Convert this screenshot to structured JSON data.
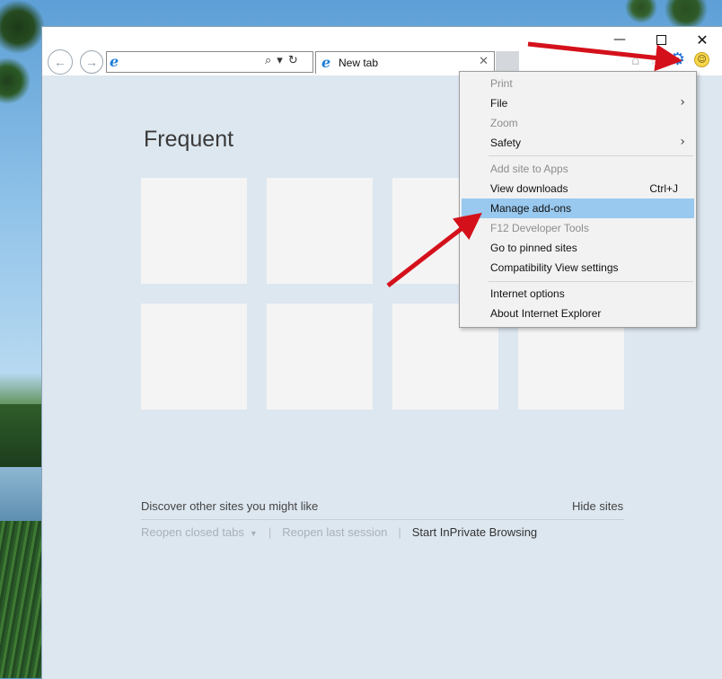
{
  "window": {
    "minimize_glyph": "—",
    "close_glyph": "✕"
  },
  "navbar": {
    "back_icon": "←",
    "forward_icon": "→",
    "address_value": "",
    "address_placeholder": "",
    "search_glyph": "⌕",
    "dropdown_glyph": "▾",
    "refresh_glyph": "↻",
    "ie_glyph": "e",
    "tab_title": "New tab",
    "tab_close_glyph": "✕",
    "home_glyph": "⌂",
    "star_glyph": "☆",
    "gear_glyph": "⚙",
    "smile_glyph": "☺"
  },
  "content": {
    "heading": "Frequent",
    "discover_text": "Discover other sites you might like",
    "hide_sites": "Hide sites",
    "reopen_closed_tabs": "Reopen closed tabs",
    "reopen_last_session": "Reopen last session",
    "start_inprivate": "Start InPrivate Browsing",
    "separator": "|",
    "caret": "▼"
  },
  "menu": {
    "items": [
      {
        "label": "Print",
        "disabled": true
      },
      {
        "label": "File",
        "submenu": "›"
      },
      {
        "label": "Zoom",
        "disabled": true
      },
      {
        "label": "Safety",
        "submenu": "›"
      },
      {
        "label": "Add site to Apps",
        "disabled": true
      },
      {
        "label": "View downloads",
        "shortcut": "Ctrl+J"
      },
      {
        "label": "Manage add-ons",
        "highlighted": true
      },
      {
        "label": "F12 Developer Tools",
        "disabled": true
      },
      {
        "label": "Go to pinned sites"
      },
      {
        "label": "Compatibility View settings"
      },
      {
        "label": "Internet options"
      },
      {
        "label": "About Internet Explorer"
      }
    ]
  },
  "colors": {
    "accent": "#1f6fd6",
    "highlight": "#99c9ef",
    "arrow": "#d4111b"
  }
}
